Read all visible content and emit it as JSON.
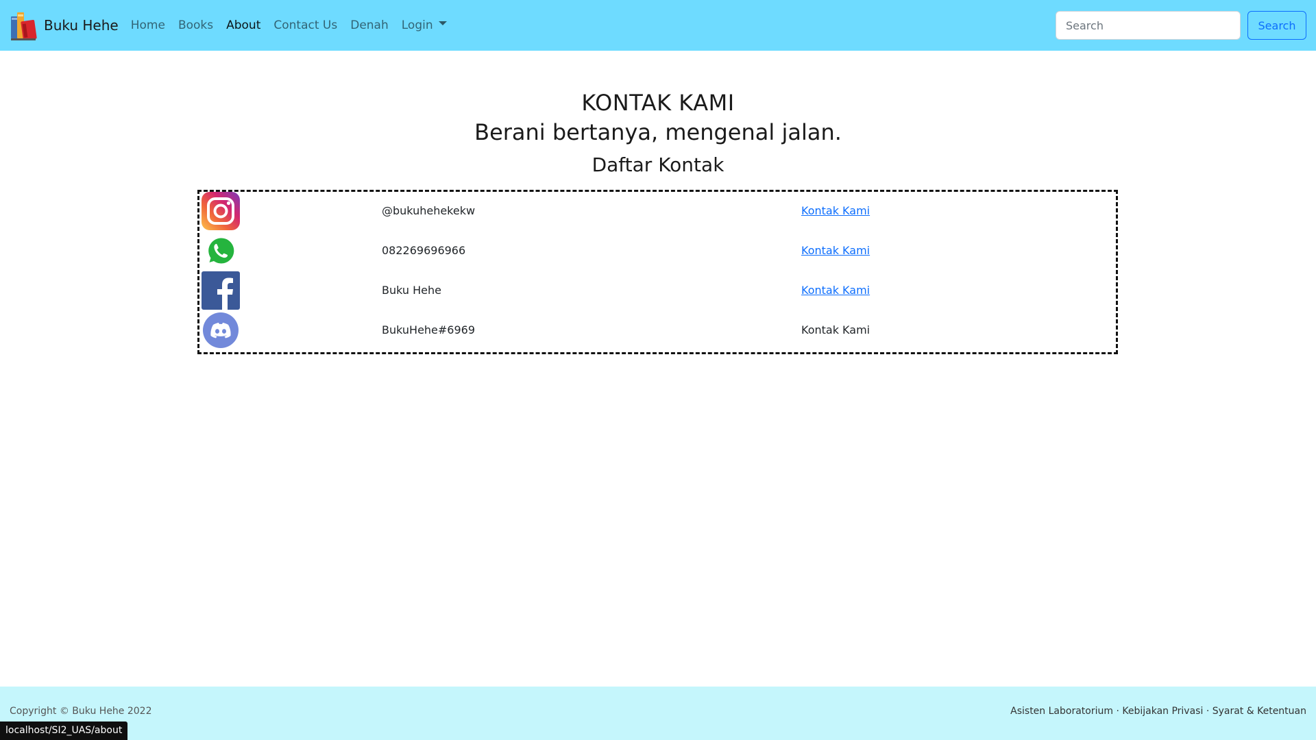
{
  "navbar": {
    "brand": "Buku Hehe",
    "links": [
      {
        "label": "Home"
      },
      {
        "label": "Books"
      },
      {
        "label": "About"
      },
      {
        "label": "Contact Us"
      },
      {
        "label": "Denah"
      },
      {
        "label": "Login"
      }
    ],
    "search_placeholder": "Search",
    "search_button": "Search",
    "background_color": "#6edbff"
  },
  "main": {
    "title": "KONTAK KAMI",
    "subtitle": "Berani bertanya, mengenal jalan.",
    "list_heading": "Daftar Kontak",
    "contacts": [
      {
        "icon": "instagram-icon",
        "value": "@bukuhehekekw",
        "link_label": "Kontak Kami",
        "is_link": true
      },
      {
        "icon": "whatsapp-icon",
        "value": "082269696966",
        "link_label": "Kontak Kami",
        "is_link": true
      },
      {
        "icon": "facebook-icon",
        "value": "Buku Hehe",
        "link_label": "Kontak Kami",
        "is_link": true
      },
      {
        "icon": "discord-icon",
        "value": "BukuHehe#6969",
        "link_label": "Kontak Kami",
        "is_link": false
      }
    ]
  },
  "footer": {
    "copyright": "Copyright © Buku Hehe 2022",
    "links": [
      "Asisten Laboratorium",
      "Kebijakan Privasi",
      "Syarat & Ketentuan"
    ],
    "separator": "·",
    "background_color": "#c5f6fc"
  },
  "status_bar": {
    "url": "localhost/SI2_UAS/about"
  }
}
